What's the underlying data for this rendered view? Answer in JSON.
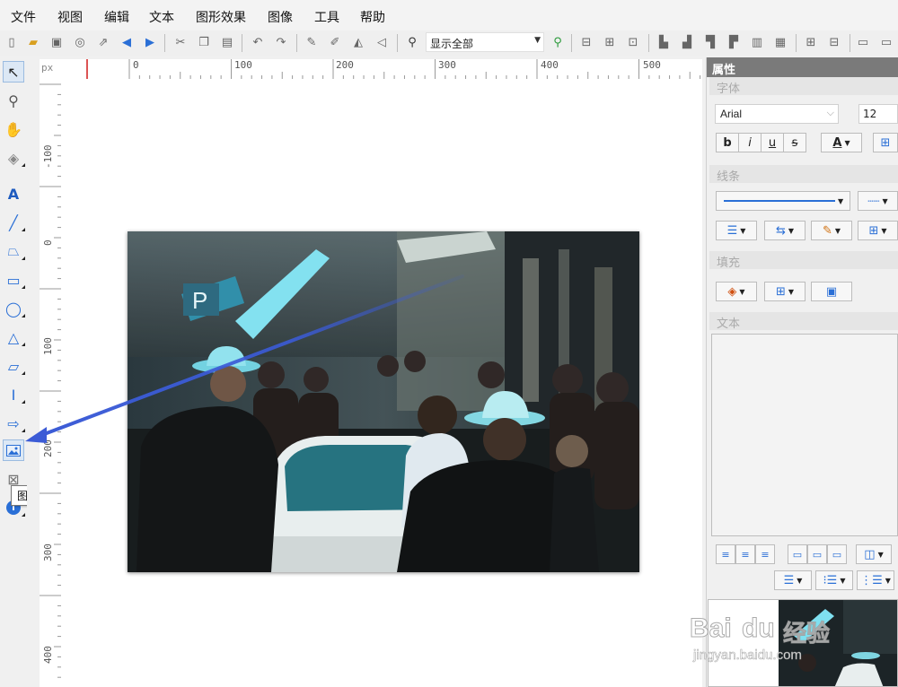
{
  "menu": [
    "文件",
    "视图",
    "编辑",
    "文本",
    "图形效果",
    "图像",
    "工具",
    "帮助"
  ],
  "toolbar": {
    "zoom_value": "显示全部",
    "icons": [
      "new-file-icon",
      "open-folder-icon",
      "save-icon",
      "web-icon",
      "export-icon",
      "back-arrow-icon",
      "forward-arrow-icon",
      "cut-icon",
      "copy-icon",
      "paste-icon",
      "undo-icon",
      "redo-icon",
      "edit-icon",
      "brush-icon",
      "flip-horizontal-icon",
      "flip-vertical-icon",
      "zoom-icon",
      "zoom-in-icon"
    ]
  },
  "ruler": {
    "unit": "px",
    "top_labels": [
      "0",
      "100",
      "200",
      "300",
      "400",
      "500"
    ],
    "left_labels": [
      "-100",
      "0",
      "100",
      "200",
      "300",
      "400"
    ]
  },
  "left_tools": {
    "tooltip": "图像",
    "selected": "image-tool"
  },
  "properties": {
    "title": "属性",
    "font_section": "字体",
    "font_family": "Arial",
    "font_size": "12",
    "bold": "b",
    "italic": "i",
    "underline": "u",
    "strike": "s",
    "font_color": "A",
    "line_section": "线条",
    "fill_section": "填充",
    "text_section": "文本"
  },
  "watermark": {
    "brand": "Bai",
    "brand2": "du",
    "jingyan": "经验",
    "url": "jingyan.baidu.com"
  },
  "colors": {
    "accent": "#2a6fd6",
    "arrow": "#3b5bd6",
    "panel_title": "#7a7a7a"
  }
}
